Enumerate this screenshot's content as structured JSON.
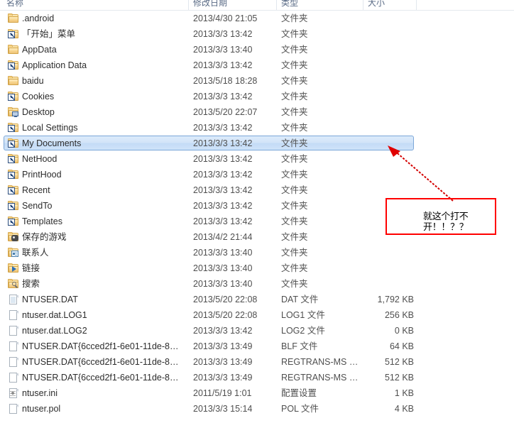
{
  "window": {
    "app": "Windows Explorer",
    "view": "details-list"
  },
  "columns": {
    "name": "名称",
    "date_modified": "修改日期",
    "type": "类型",
    "size": "大小"
  },
  "rows": [
    {
      "name": ".android",
      "date": "2013/4/30 21:05",
      "type": "文件夹",
      "size": "",
      "icon": "folder-icon",
      "selected": false
    },
    {
      "name": "「开始」菜单",
      "date": "2013/3/3 13:42",
      "type": "文件夹",
      "size": "",
      "icon": "folder-shortcut-icon",
      "selected": false
    },
    {
      "name": "AppData",
      "date": "2013/3/3 13:40",
      "type": "文件夹",
      "size": "",
      "icon": "folder-icon",
      "selected": false
    },
    {
      "name": "Application Data",
      "date": "2013/3/3 13:42",
      "type": "文件夹",
      "size": "",
      "icon": "folder-shortcut-icon",
      "selected": false
    },
    {
      "name": "baidu",
      "date": "2013/5/18 18:28",
      "type": "文件夹",
      "size": "",
      "icon": "folder-icon",
      "selected": false
    },
    {
      "name": "Cookies",
      "date": "2013/3/3 13:42",
      "type": "文件夹",
      "size": "",
      "icon": "folder-shortcut-icon",
      "selected": false
    },
    {
      "name": "Desktop",
      "date": "2013/5/20 22:07",
      "type": "文件夹",
      "size": "",
      "icon": "folder-desktop-icon",
      "selected": false
    },
    {
      "name": "Local Settings",
      "date": "2013/3/3 13:42",
      "type": "文件夹",
      "size": "",
      "icon": "folder-shortcut-icon",
      "selected": false
    },
    {
      "name": "My Documents",
      "date": "2013/3/3 13:42",
      "type": "文件夹",
      "size": "",
      "icon": "folder-shortcut-icon",
      "selected": true
    },
    {
      "name": "NetHood",
      "date": "2013/3/3 13:42",
      "type": "文件夹",
      "size": "",
      "icon": "folder-shortcut-icon",
      "selected": false
    },
    {
      "name": "PrintHood",
      "date": "2013/3/3 13:42",
      "type": "文件夹",
      "size": "",
      "icon": "folder-shortcut-icon",
      "selected": false
    },
    {
      "name": "Recent",
      "date": "2013/3/3 13:42",
      "type": "文件夹",
      "size": "",
      "icon": "folder-shortcut-icon",
      "selected": false
    },
    {
      "name": "SendTo",
      "date": "2013/3/3 13:42",
      "type": "文件夹",
      "size": "",
      "icon": "folder-shortcut-icon",
      "selected": false
    },
    {
      "name": "Templates",
      "date": "2013/3/3 13:42",
      "type": "文件夹",
      "size": "",
      "icon": "folder-shortcut-icon",
      "selected": false
    },
    {
      "name": "保存的游戏",
      "date": "2013/4/2 21:44",
      "type": "文件夹",
      "size": "",
      "icon": "folder-savedgames-icon",
      "selected": false
    },
    {
      "name": "联系人",
      "date": "2013/3/3 13:40",
      "type": "文件夹",
      "size": "",
      "icon": "folder-contacts-icon",
      "selected": false
    },
    {
      "name": "链接",
      "date": "2013/3/3 13:40",
      "type": "文件夹",
      "size": "",
      "icon": "folder-links-icon",
      "selected": false
    },
    {
      "name": "搜索",
      "date": "2013/3/3 13:40",
      "type": "文件夹",
      "size": "",
      "icon": "folder-searches-icon",
      "selected": false
    },
    {
      "name": "NTUSER.DAT",
      "date": "2013/5/20 22:08",
      "type": "DAT 文件",
      "size": "1,792 KB",
      "icon": "dat-file-icon",
      "selected": false
    },
    {
      "name": "ntuser.dat.LOG1",
      "date": "2013/5/20 22:08",
      "type": "LOG1 文件",
      "size": "256 KB",
      "icon": "file-icon",
      "selected": false
    },
    {
      "name": "ntuser.dat.LOG2",
      "date": "2013/3/3 13:42",
      "type": "LOG2 文件",
      "size": "0 KB",
      "icon": "file-icon",
      "selected": false
    },
    {
      "name": "NTUSER.DAT{6cced2f1-6e01-11de-8…",
      "date": "2013/3/3 13:49",
      "type": "BLF 文件",
      "size": "64 KB",
      "icon": "file-icon",
      "selected": false
    },
    {
      "name": "NTUSER.DAT{6cced2f1-6e01-11de-8…",
      "date": "2013/3/3 13:49",
      "type": "REGTRANS-MS …",
      "size": "512 KB",
      "icon": "file-icon",
      "selected": false
    },
    {
      "name": "NTUSER.DAT{6cced2f1-6e01-11de-8…",
      "date": "2013/3/3 13:49",
      "type": "REGTRANS-MS …",
      "size": "512 KB",
      "icon": "file-icon",
      "selected": false
    },
    {
      "name": "ntuser.ini",
      "date": "2011/5/19 1:01",
      "type": "配置设置",
      "size": "1 KB",
      "icon": "ini-file-icon",
      "selected": false
    },
    {
      "name": "ntuser.pol",
      "date": "2013/3/3 15:14",
      "type": "POL 文件",
      "size": "4 KB",
      "icon": "file-icon",
      "selected": false
    }
  ],
  "annotation": {
    "text": "就这个打不开！！？？",
    "box_color": "#ff0000",
    "arrow_color": "#d40000",
    "text_color": "#000000",
    "points_at": "My Documents"
  },
  "colors": {
    "selection_border": "#7ca7d8",
    "selection_fill": "#d2e4f8",
    "header_text": "#5a6b86",
    "row_text": "#2c2c2c",
    "secondary_text": "#4f4f4f"
  }
}
